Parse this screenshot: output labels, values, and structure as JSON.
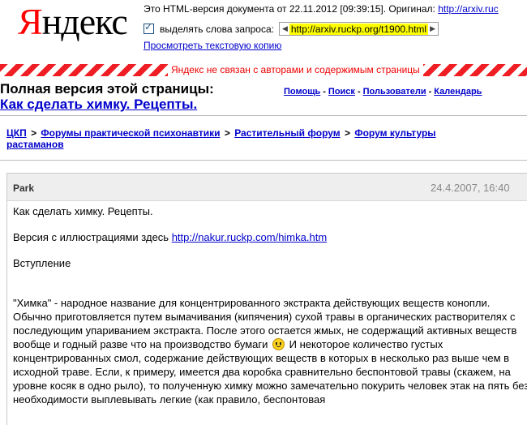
{
  "yandex": {
    "logo": "Яндекс",
    "cache_text": "Это HTML-версия документа от 22.11.2012 [09:39:15]. Оригинал:",
    "original_link": "http://arxiv.ruc",
    "highlight_label": "выделять слова запроса:",
    "url_value": "http://arxiv.ruckp.org/t1900.html",
    "text_copy_link": "Просмотреть текстовую копию",
    "disclaimer": "Яндекс не связан с авторами и содержимым страницы"
  },
  "page": {
    "full_version_title": "Полная версия этой страницы:",
    "thread_title": "Как сделать химку. Рецепты.",
    "nav": [
      "Помощь",
      "Поиск",
      "Пользователи",
      "Календарь"
    ],
    "breadcrumb": [
      "ЦКП",
      "Форумы практической психонавтики",
      "Растительный форум",
      "Форум культуры растаманов"
    ],
    "breadcrumb_sep": ">"
  },
  "post": {
    "author": "Park",
    "date": "24.4.2007, 16:40",
    "line1": "Как сделать химку. Рецепты.",
    "line2_prefix": "Версия с иллюстрациями здесь ",
    "line2_link": "http://nakur.ruckp.com/himka.htm",
    "line3": "Вступление",
    "para_before_smiley": "\"Химка\" - народное название для концентрированного экстракта действующих веществ конопли. Обычно приготовляется путем вымачивания (кипячения) сухой травы в органических растворителях с последующим упариванием экстракта. После этого остается жмых, не содержащий активных веществ вообще и годный разве что на производство бумаги",
    "para_after_smiley": " И некоторое количество густых концентрированных смол, содержание действующих веществ в которых в несколько раз выше чем в исходной траве. Если, к примеру, имеется два коробка сравнительно беспонтовой травы (скажем, на уровне косяк в одно рыло), то полученную химку можно замечательно покурить человек этак на пять без необходимости выплевывать легкие (как правило, беспонтовая",
    "smiley_icon": "smile-icon"
  }
}
